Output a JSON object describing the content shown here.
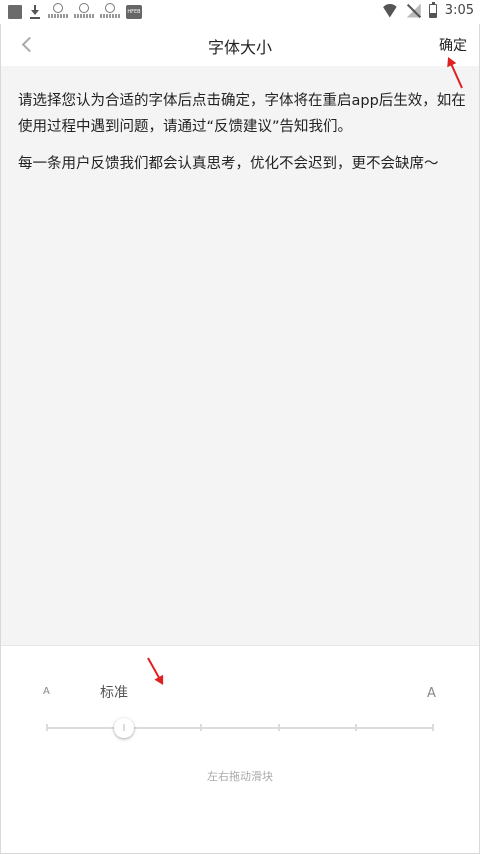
{
  "status_bar": {
    "time": "3:05",
    "left_icons": [
      "app-square-icon",
      "download-icon",
      "app-mini-icon",
      "app-mini-icon",
      "app-mini-icon",
      "app-badge-icon"
    ],
    "app_badge_text": "HFEB",
    "right_icons": [
      "wifi-icon",
      "no-signal-icon",
      "battery-icon"
    ]
  },
  "header": {
    "title": "字体大小",
    "confirm_label": "确定",
    "back_icon": "chevron-left-icon"
  },
  "preview": {
    "paragraph_1": "请选择您认为合适的字体后点击确定，字体将在重启app后生效，如在使用过程中遇到问题，请通过“反馈建议”告知我们。",
    "paragraph_2": "每一条用户反馈我们都会认真思考，优化不会迟到，更不会缺席～",
    "background_color": "#f4f4f4"
  },
  "font_size_control": {
    "small_a_label": "A",
    "large_a_label": "A",
    "current_level_label": "标准",
    "steps": 6,
    "selected_index": 1,
    "hint": "左右拖动滑块"
  },
  "annotation_color": "#e02020"
}
